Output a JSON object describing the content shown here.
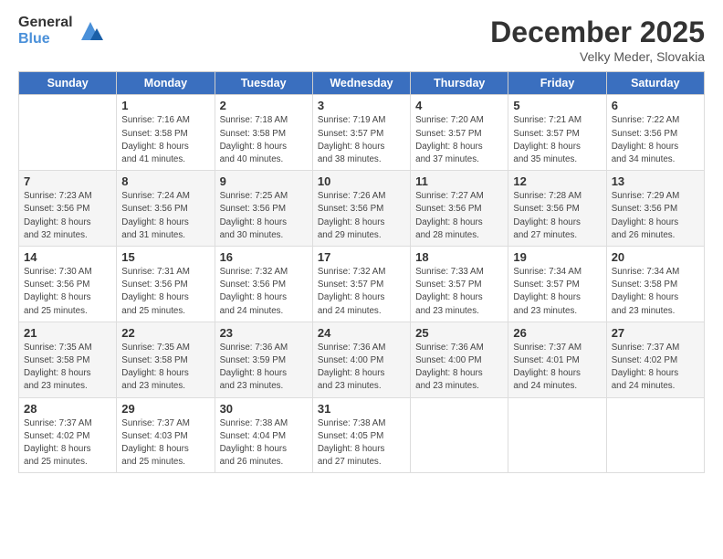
{
  "header": {
    "logo_general": "General",
    "logo_blue": "Blue",
    "main_title": "December 2025",
    "subtitle": "Velky Meder, Slovakia"
  },
  "days_of_week": [
    "Sunday",
    "Monday",
    "Tuesday",
    "Wednesday",
    "Thursday",
    "Friday",
    "Saturday"
  ],
  "weeks": [
    [
      {
        "day": "",
        "sunrise": "",
        "sunset": "",
        "daylight": ""
      },
      {
        "day": "1",
        "sunrise": "Sunrise: 7:16 AM",
        "sunset": "Sunset: 3:58 PM",
        "daylight": "Daylight: 8 hours and 41 minutes."
      },
      {
        "day": "2",
        "sunrise": "Sunrise: 7:18 AM",
        "sunset": "Sunset: 3:58 PM",
        "daylight": "Daylight: 8 hours and 40 minutes."
      },
      {
        "day": "3",
        "sunrise": "Sunrise: 7:19 AM",
        "sunset": "Sunset: 3:57 PM",
        "daylight": "Daylight: 8 hours and 38 minutes."
      },
      {
        "day": "4",
        "sunrise": "Sunrise: 7:20 AM",
        "sunset": "Sunset: 3:57 PM",
        "daylight": "Daylight: 8 hours and 37 minutes."
      },
      {
        "day": "5",
        "sunrise": "Sunrise: 7:21 AM",
        "sunset": "Sunset: 3:57 PM",
        "daylight": "Daylight: 8 hours and 35 minutes."
      },
      {
        "day": "6",
        "sunrise": "Sunrise: 7:22 AM",
        "sunset": "Sunset: 3:56 PM",
        "daylight": "Daylight: 8 hours and 34 minutes."
      }
    ],
    [
      {
        "day": "7",
        "sunrise": "Sunrise: 7:23 AM",
        "sunset": "Sunset: 3:56 PM",
        "daylight": "Daylight: 8 hours and 32 minutes."
      },
      {
        "day": "8",
        "sunrise": "Sunrise: 7:24 AM",
        "sunset": "Sunset: 3:56 PM",
        "daylight": "Daylight: 8 hours and 31 minutes."
      },
      {
        "day": "9",
        "sunrise": "Sunrise: 7:25 AM",
        "sunset": "Sunset: 3:56 PM",
        "daylight": "Daylight: 8 hours and 30 minutes."
      },
      {
        "day": "10",
        "sunrise": "Sunrise: 7:26 AM",
        "sunset": "Sunset: 3:56 PM",
        "daylight": "Daylight: 8 hours and 29 minutes."
      },
      {
        "day": "11",
        "sunrise": "Sunrise: 7:27 AM",
        "sunset": "Sunset: 3:56 PM",
        "daylight": "Daylight: 8 hours and 28 minutes."
      },
      {
        "day": "12",
        "sunrise": "Sunrise: 7:28 AM",
        "sunset": "Sunset: 3:56 PM",
        "daylight": "Daylight: 8 hours and 27 minutes."
      },
      {
        "day": "13",
        "sunrise": "Sunrise: 7:29 AM",
        "sunset": "Sunset: 3:56 PM",
        "daylight": "Daylight: 8 hours and 26 minutes."
      }
    ],
    [
      {
        "day": "14",
        "sunrise": "Sunrise: 7:30 AM",
        "sunset": "Sunset: 3:56 PM",
        "daylight": "Daylight: 8 hours and 25 minutes."
      },
      {
        "day": "15",
        "sunrise": "Sunrise: 7:31 AM",
        "sunset": "Sunset: 3:56 PM",
        "daylight": "Daylight: 8 hours and 25 minutes."
      },
      {
        "day": "16",
        "sunrise": "Sunrise: 7:32 AM",
        "sunset": "Sunset: 3:56 PM",
        "daylight": "Daylight: 8 hours and 24 minutes."
      },
      {
        "day": "17",
        "sunrise": "Sunrise: 7:32 AM",
        "sunset": "Sunset: 3:57 PM",
        "daylight": "Daylight: 8 hours and 24 minutes."
      },
      {
        "day": "18",
        "sunrise": "Sunrise: 7:33 AM",
        "sunset": "Sunset: 3:57 PM",
        "daylight": "Daylight: 8 hours and 23 minutes."
      },
      {
        "day": "19",
        "sunrise": "Sunrise: 7:34 AM",
        "sunset": "Sunset: 3:57 PM",
        "daylight": "Daylight: 8 hours and 23 minutes."
      },
      {
        "day": "20",
        "sunrise": "Sunrise: 7:34 AM",
        "sunset": "Sunset: 3:58 PM",
        "daylight": "Daylight: 8 hours and 23 minutes."
      }
    ],
    [
      {
        "day": "21",
        "sunrise": "Sunrise: 7:35 AM",
        "sunset": "Sunset: 3:58 PM",
        "daylight": "Daylight: 8 hours and 23 minutes."
      },
      {
        "day": "22",
        "sunrise": "Sunrise: 7:35 AM",
        "sunset": "Sunset: 3:58 PM",
        "daylight": "Daylight: 8 hours and 23 minutes."
      },
      {
        "day": "23",
        "sunrise": "Sunrise: 7:36 AM",
        "sunset": "Sunset: 3:59 PM",
        "daylight": "Daylight: 8 hours and 23 minutes."
      },
      {
        "day": "24",
        "sunrise": "Sunrise: 7:36 AM",
        "sunset": "Sunset: 4:00 PM",
        "daylight": "Daylight: 8 hours and 23 minutes."
      },
      {
        "day": "25",
        "sunrise": "Sunrise: 7:36 AM",
        "sunset": "Sunset: 4:00 PM",
        "daylight": "Daylight: 8 hours and 23 minutes."
      },
      {
        "day": "26",
        "sunrise": "Sunrise: 7:37 AM",
        "sunset": "Sunset: 4:01 PM",
        "daylight": "Daylight: 8 hours and 24 minutes."
      },
      {
        "day": "27",
        "sunrise": "Sunrise: 7:37 AM",
        "sunset": "Sunset: 4:02 PM",
        "daylight": "Daylight: 8 hours and 24 minutes."
      }
    ],
    [
      {
        "day": "28",
        "sunrise": "Sunrise: 7:37 AM",
        "sunset": "Sunset: 4:02 PM",
        "daylight": "Daylight: 8 hours and 25 minutes."
      },
      {
        "day": "29",
        "sunrise": "Sunrise: 7:37 AM",
        "sunset": "Sunset: 4:03 PM",
        "daylight": "Daylight: 8 hours and 25 minutes."
      },
      {
        "day": "30",
        "sunrise": "Sunrise: 7:38 AM",
        "sunset": "Sunset: 4:04 PM",
        "daylight": "Daylight: 8 hours and 26 minutes."
      },
      {
        "day": "31",
        "sunrise": "Sunrise: 7:38 AM",
        "sunset": "Sunset: 4:05 PM",
        "daylight": "Daylight: 8 hours and 27 minutes."
      },
      {
        "day": "",
        "sunrise": "",
        "sunset": "",
        "daylight": ""
      },
      {
        "day": "",
        "sunrise": "",
        "sunset": "",
        "daylight": ""
      },
      {
        "day": "",
        "sunrise": "",
        "sunset": "",
        "daylight": ""
      }
    ]
  ]
}
